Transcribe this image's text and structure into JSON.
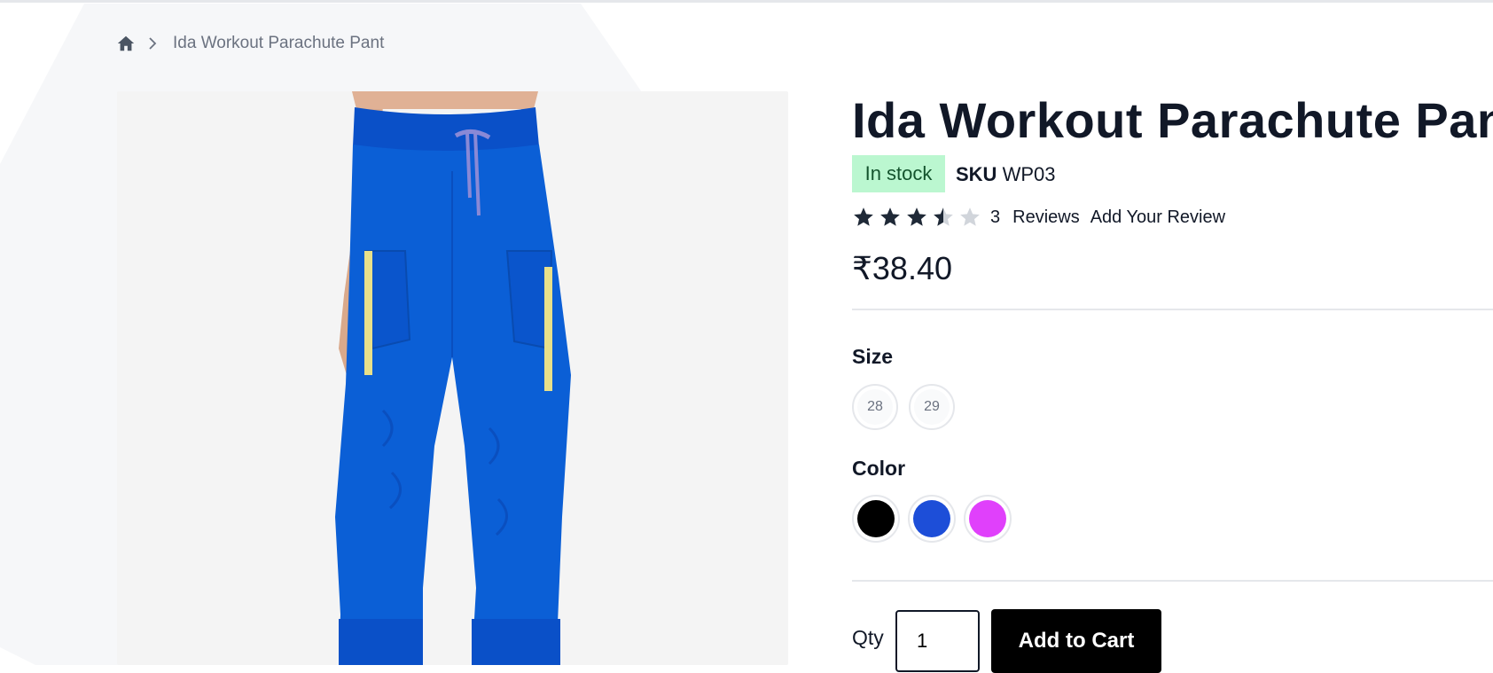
{
  "breadcrumb": {
    "home_icon": "home-icon",
    "separator_icon": "chevron-right-icon",
    "current": "Ida Workout Parachute Pant"
  },
  "product": {
    "title": "Ida Workout Parachute Pant",
    "stock_status": "In stock",
    "sku_label": "SKU",
    "sku_value": "WP03",
    "rating": {
      "value": 3.5,
      "max": 5,
      "count": "3",
      "reviews_label": "Reviews",
      "add_review_label": "Add Your Review"
    },
    "price": "₹38.40",
    "image_icon": "product-photo-pants"
  },
  "options": {
    "size_label": "Size",
    "sizes": [
      "28",
      "29"
    ],
    "color_label": "Color",
    "colors": [
      {
        "name": "black",
        "hex": "#000000"
      },
      {
        "name": "blue",
        "hex": "#1d4ed8"
      },
      {
        "name": "magenta",
        "hex": "#e040fb"
      }
    ]
  },
  "cart": {
    "qty_label": "Qty",
    "qty_value": "1",
    "add_to_cart_label": "Add to Cart"
  },
  "colors": {
    "stock_bg": "#bbf7d0",
    "stock_text": "#14532d",
    "button_bg": "#000000",
    "product_blue": "#0b5fd6"
  }
}
